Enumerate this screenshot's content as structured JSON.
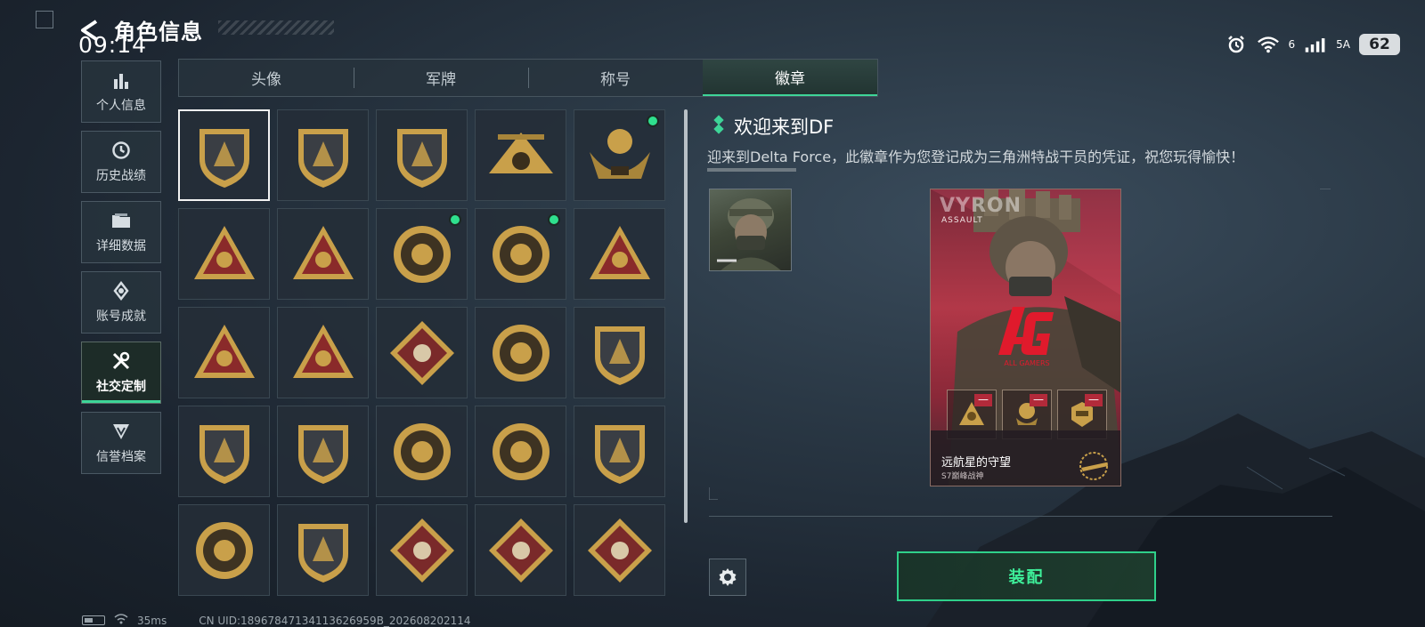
{
  "status_bar": {
    "time": "09:14",
    "network_label": "6",
    "signal_label": "5A",
    "battery": "62"
  },
  "header": {
    "title": "角色信息"
  },
  "sidebar": {
    "items": [
      {
        "label": "个人信息",
        "icon": "bar-chart-icon",
        "active": false
      },
      {
        "label": "历史战绩",
        "icon": "history-icon",
        "active": false
      },
      {
        "label": "详细数据",
        "icon": "folder-icon",
        "active": false
      },
      {
        "label": "账号成就",
        "icon": "achievement-icon",
        "active": false
      },
      {
        "label": "社交定制",
        "icon": "tools-icon",
        "active": true
      },
      {
        "label": "信誉档案",
        "icon": "credit-icon",
        "active": false
      }
    ]
  },
  "tabs": [
    {
      "label": "头像",
      "active": false
    },
    {
      "label": "军牌",
      "active": false
    },
    {
      "label": "称号",
      "active": false
    },
    {
      "label": "徽章",
      "active": true
    }
  ],
  "badges": [
    {
      "icon": "delta-shield-badge-icon",
      "selected": true,
      "new": false
    },
    {
      "icon": "helicopter-badge-icon",
      "selected": false,
      "new": false
    },
    {
      "icon": "dagger-shield-badge-icon",
      "selected": false,
      "new": false
    },
    {
      "icon": "s9-plane-badge-icon",
      "selected": false,
      "new": false
    },
    {
      "icon": "s18-eagle-badge-icon",
      "selected": false,
      "new": true
    },
    {
      "icon": "lotus-triangle-badge-icon",
      "selected": false,
      "new": false
    },
    {
      "icon": "number-one-triangle-badge-icon",
      "selected": false,
      "new": false
    },
    {
      "icon": "delta-force-2025-badge-icon",
      "selected": false,
      "new": true
    },
    {
      "icon": "delta-force-2026-badge-icon",
      "selected": false,
      "new": true
    },
    {
      "icon": "usb-triangle-badge-icon",
      "selected": false,
      "new": false
    },
    {
      "icon": "soldiers-triangle-badge-icon",
      "selected": false,
      "new": false
    },
    {
      "icon": "rocket-triangle-badge-icon",
      "selected": false,
      "new": false
    },
    {
      "icon": "rose-diamond-badge-icon",
      "selected": false,
      "new": false
    },
    {
      "icon": "star-round-badge-icon",
      "selected": false,
      "new": false
    },
    {
      "icon": "wing-shield-badge-icon",
      "selected": false,
      "new": false
    },
    {
      "icon": "stars-shield-badge-icon",
      "selected": false,
      "new": false
    },
    {
      "icon": "green-gem-shield-badge-icon",
      "selected": false,
      "new": false
    },
    {
      "icon": "green-round-badge-icon",
      "selected": false,
      "new": false
    },
    {
      "icon": "tank-burst-badge-icon",
      "selected": false,
      "new": false
    },
    {
      "icon": "crossed-rifles-shield-badge-icon",
      "selected": false,
      "new": false
    },
    {
      "icon": "rifle-round-badge-icon",
      "selected": false,
      "new": false
    },
    {
      "icon": "sword-shield-badge-icon",
      "selected": false,
      "new": false
    },
    {
      "icon": "wolf-diamond-badge-icon",
      "selected": false,
      "new": false
    },
    {
      "icon": "wolf-diamond-badge-icon",
      "selected": false,
      "new": false
    },
    {
      "icon": "beast-diamond-badge-icon",
      "selected": false,
      "new": false
    }
  ],
  "detail": {
    "name": "欢迎来到DF",
    "description": "迎来到Delta Force，此徽章作为您登记成为三角洲特战干员的凭证，祝您玩得愉快！"
  },
  "operator_card": {
    "name": "VYRON",
    "role": "ASSAULT",
    "logo_text": "AG",
    "logo_subtext": "ALL GAMERS",
    "title_name": "远航星的守望",
    "title_sub": "S7巅峰战神"
  },
  "actions": {
    "equip_label": "装配"
  },
  "footer": {
    "ping": "35ms",
    "uid": "CN UID:18967847134113626959B_202608202114"
  },
  "colors": {
    "accent": "#3ed598",
    "card_red": "#b23848",
    "logo_red": "#e01a2c",
    "badge_gold": "#c9a04a"
  }
}
